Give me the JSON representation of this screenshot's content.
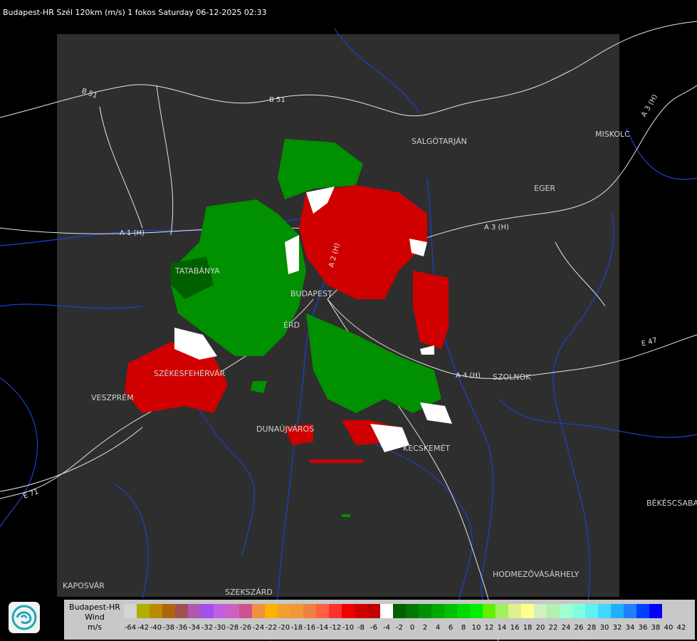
{
  "title": "Budapest-HR Szél 120km (m/s) 1 fokos Saturday 06-12-2025 02:33",
  "cities": [
    "SALGÓTARJÁN",
    "MISKOLC",
    "EGER",
    "TATABÁNYA",
    "BUDAPEST",
    "ÉRD",
    "SZÉKESFEHÉRVÁR",
    "VESZPRÉM",
    "DUNAÚJVÁROS",
    "KECSKEMÉT",
    "SZOLNOK",
    "BÉKÉSCSABA",
    "HODMEZŐVÁSÁRHELY",
    "KAPOSVÁR",
    "SZEKSZÁRD"
  ],
  "roads": [
    "B 51",
    "B 51",
    "A 1 (H)",
    "A 2 (H)",
    "A 3 (H)",
    "A 3 (H)",
    "A 4 (H)",
    "E 47",
    "E 71"
  ],
  "legend": {
    "title_lines": [
      "Budapest-HR",
      "Wind",
      "m/s"
    ],
    "colors": [
      "#d4d4d4",
      "#b0b000",
      "#b88c00",
      "#b06410",
      "#a05050",
      "#b058b0",
      "#a050f0",
      "#c060e0",
      "#d060c0",
      "#d05090",
      "#f09040",
      "#ffb000",
      "#f0a030",
      "#f09838",
      "#f08040",
      "#ff6040",
      "#ff3030",
      "#f00000",
      "#d00000",
      "#c00000",
      "#ffffff",
      "#006000",
      "#007800",
      "#009000",
      "#00a800",
      "#00c000",
      "#00d800",
      "#00f000",
      "#60f000",
      "#a0f060",
      "#e0f090",
      "#ffff90",
      "#d0f0c0",
      "#b0f0b0",
      "#a0ffd0",
      "#80ffe0",
      "#60f0f0",
      "#40d8ff",
      "#20b0ff",
      "#2080ff",
      "#0040ff",
      "#0000ff"
    ],
    "ticks": [
      "-64",
      "-42",
      "-40",
      "-38",
      "-36",
      "-34",
      "-32",
      "-30",
      "-28",
      "-26",
      "-24",
      "-22",
      "-20",
      "-18",
      "-16",
      "-14",
      "-12",
      "-10",
      "-8",
      "-6",
      "-4",
      "-2",
      "0",
      "2",
      "4",
      "6",
      "8",
      "10",
      "12",
      "14",
      "16",
      "18",
      "20",
      "22",
      "24",
      "26",
      "28",
      "30",
      "32",
      "34",
      "36",
      "38",
      "40",
      "42"
    ]
  }
}
